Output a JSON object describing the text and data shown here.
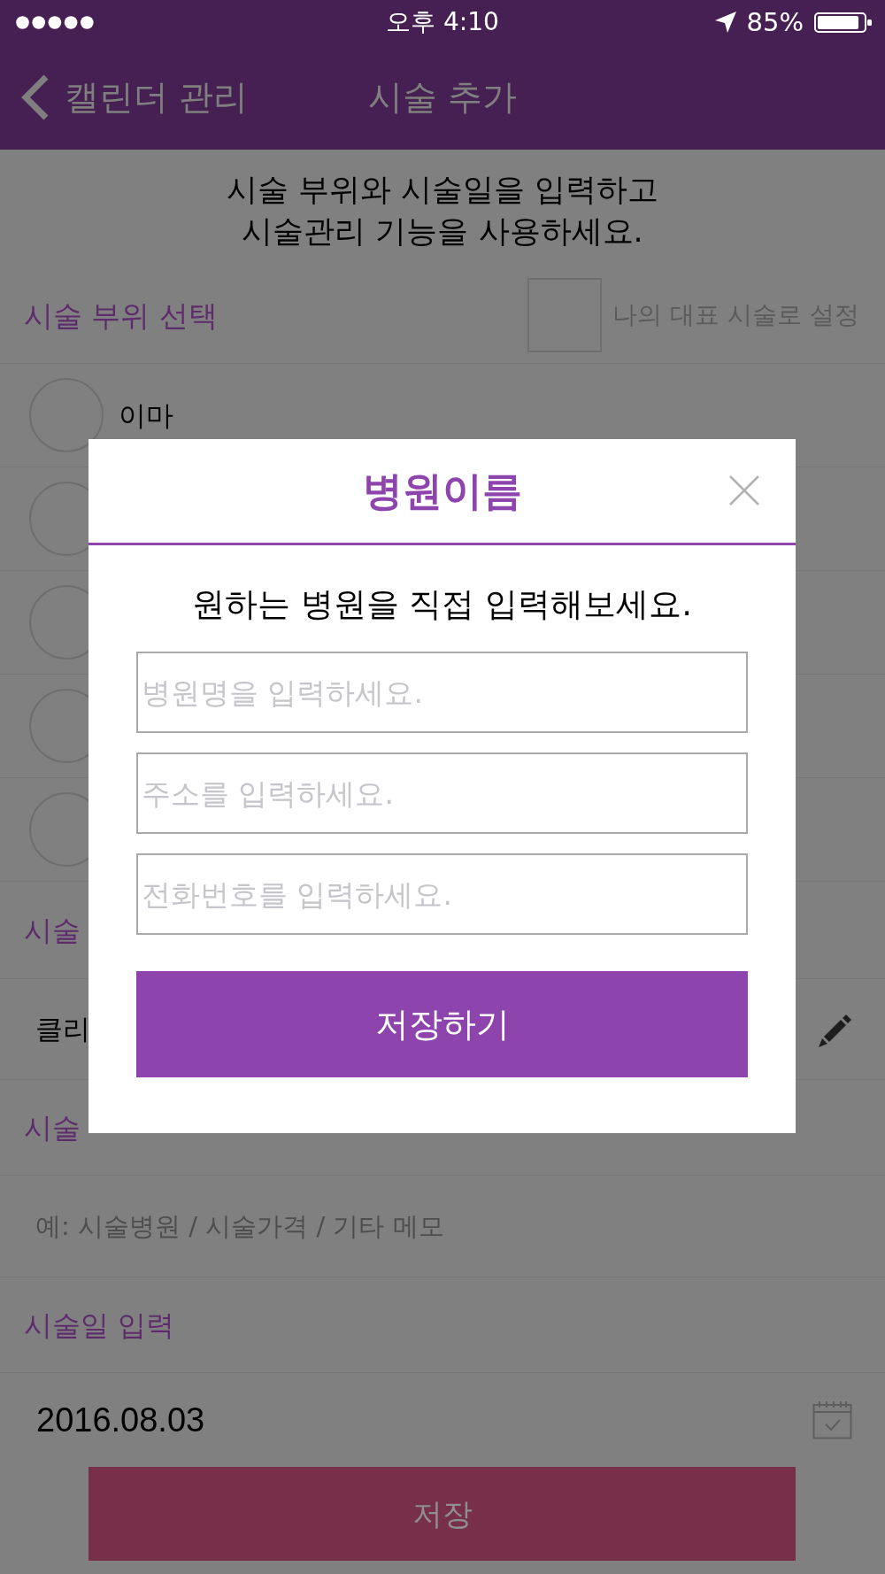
{
  "status_bar": {
    "time": "오후 4:10",
    "battery": "85%"
  },
  "nav_bar": {
    "back": "캘린더 관리",
    "title": "시술 추가"
  },
  "intro": {
    "lines": [
      "시술 부위와 시술일을 입력하고",
      "시술관리 기능을 사용하세요."
    ]
  },
  "area_section": {
    "label": "시술 부위 선택",
    "representative": {
      "label": "나의 대표 시술로 설정",
      "checked": false
    },
    "options": [
      {
        "label": "이마",
        "selected": false
      },
      {
        "selected": false
      },
      {
        "selected": false
      },
      {
        "selected": false
      },
      {
        "selected": false
      }
    ]
  },
  "procedure_section": {
    "label": "시술",
    "value": "클리"
  },
  "memo_section": {
    "label": "시술",
    "placeholder": "예: 시술병원 / 시술가격 / 기타 메모"
  },
  "date_section": {
    "label": "시술일 입력",
    "value": "2016.08.03"
  },
  "save_button": {
    "label": "저장"
  },
  "dialog": {
    "title": "병원이름",
    "message": "원하는 병원을 직접 입력해보세요.",
    "fields": [
      {
        "placeholder": "병원명을 입력하세요."
      },
      {
        "placeholder": "주소를 입력하세요."
      },
      {
        "placeholder": "전화번호를 입력하세요."
      }
    ],
    "button": "저장하기"
  }
}
